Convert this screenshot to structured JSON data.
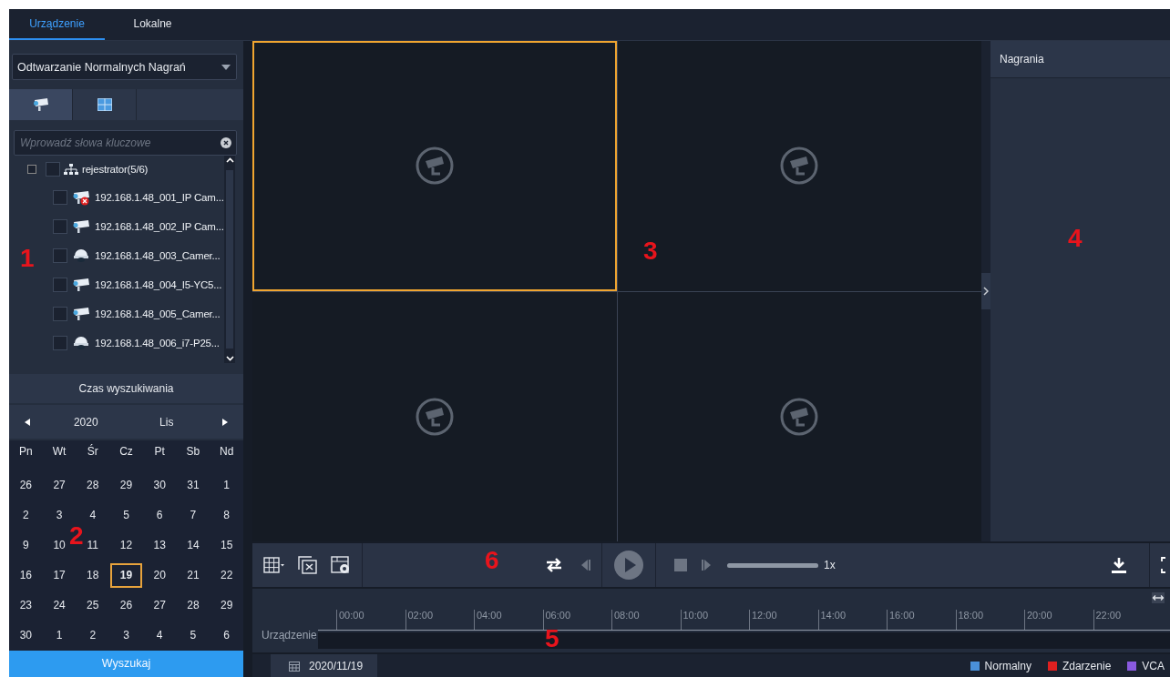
{
  "tabs": [
    {
      "label": "Urządzenie",
      "selected": true
    },
    {
      "label": "Lokalne",
      "selected": false
    }
  ],
  "mode_dropdown": {
    "value": "Odtwarzanie Normalnych Nagrań"
  },
  "view_tabs": [
    {
      "kind": "camera",
      "selected": true
    },
    {
      "kind": "grid",
      "selected": false
    }
  ],
  "search": {
    "placeholder": "Wprowadź słowa kluczowe"
  },
  "tree": {
    "label": "rejestrator(5/6)",
    "checked": false,
    "expanded": true,
    "children": [
      {
        "label": "192.168.1.48_001_IP Cam...",
        "kind": "bullet",
        "offline": true,
        "checked": false
      },
      {
        "label": "192.168.1.48_002_IP Cam...",
        "kind": "bullet",
        "offline": false,
        "checked": false
      },
      {
        "label": "192.168.1.48_003_Camer...",
        "kind": "dome",
        "offline": false,
        "checked": false
      },
      {
        "label": "192.168.1.48_004_I5-YC5...",
        "kind": "bullet",
        "offline": false,
        "checked": false
      },
      {
        "label": "192.168.1.48_005_Camer...",
        "kind": "bullet",
        "offline": false,
        "checked": false
      },
      {
        "label": "192.168.1.48_006_i7-P25...",
        "kind": "dome",
        "offline": false,
        "checked": false
      }
    ]
  },
  "calendar": {
    "title": "Czas wyszukiwania",
    "year": "2020",
    "month": "Lis",
    "weekdays": [
      "Pn",
      "Wt",
      "Śr",
      "Cz",
      "Pt",
      "Sb",
      "Nd"
    ],
    "weeks": [
      [
        {
          "day": "26",
          "selected": false
        },
        {
          "day": "27",
          "selected": false
        },
        {
          "day": "28",
          "selected": false
        },
        {
          "day": "29",
          "selected": false
        },
        {
          "day": "30",
          "selected": false
        },
        {
          "day": "31",
          "selected": false
        },
        {
          "day": "1",
          "selected": false
        }
      ],
      [
        {
          "day": "2",
          "selected": false
        },
        {
          "day": "3",
          "selected": false
        },
        {
          "day": "4",
          "selected": false
        },
        {
          "day": "5",
          "selected": false
        },
        {
          "day": "6",
          "selected": false
        },
        {
          "day": "7",
          "selected": false
        },
        {
          "day": "8",
          "selected": false
        }
      ],
      [
        {
          "day": "9",
          "selected": false
        },
        {
          "day": "10",
          "selected": false
        },
        {
          "day": "11",
          "selected": false
        },
        {
          "day": "12",
          "selected": false
        },
        {
          "day": "13",
          "selected": false
        },
        {
          "day": "14",
          "selected": false
        },
        {
          "day": "15",
          "selected": false
        }
      ],
      [
        {
          "day": "16",
          "selected": false
        },
        {
          "day": "17",
          "selected": false
        },
        {
          "day": "18",
          "selected": false
        },
        {
          "day": "19",
          "selected": true
        },
        {
          "day": "20",
          "selected": false
        },
        {
          "day": "21",
          "selected": false
        },
        {
          "day": "22",
          "selected": false
        }
      ],
      [
        {
          "day": "23",
          "selected": false
        },
        {
          "day": "24",
          "selected": false
        },
        {
          "day": "25",
          "selected": false
        },
        {
          "day": "26",
          "selected": false
        },
        {
          "day": "27",
          "selected": false
        },
        {
          "day": "28",
          "selected": false
        },
        {
          "day": "29",
          "selected": false
        }
      ],
      [
        {
          "day": "30",
          "selected": false
        },
        {
          "day": "1",
          "selected": false
        },
        {
          "day": "2",
          "selected": false
        },
        {
          "day": "3",
          "selected": false
        },
        {
          "day": "4",
          "selected": false
        },
        {
          "day": "5",
          "selected": false
        },
        {
          "day": "6",
          "selected": false
        }
      ]
    ]
  },
  "search_button": "Wyszukaj",
  "video_cells": [
    {
      "selected": true
    },
    {
      "selected": false
    },
    {
      "selected": false
    },
    {
      "selected": false
    }
  ],
  "recordings_panel": {
    "title": "Nagrania"
  },
  "playback": {
    "level": 1,
    "speed": "1x"
  },
  "timeline": {
    "label": "Urządzenie",
    "ticks": [
      "00:00",
      "02:00",
      "04:00",
      "06:00",
      "08:00",
      "10:00",
      "12:00",
      "14:00",
      "16:00",
      "18:00",
      "20:00",
      "22:00"
    ]
  },
  "status_bar": {
    "date": "2020/11/19",
    "legend": [
      {
        "label": "Normalny",
        "color": "#4a90d9"
      },
      {
        "label": "Zdarzenie",
        "color": "#e02020"
      },
      {
        "label": "VCA",
        "color": "#8a5ae0"
      }
    ]
  },
  "annotations": [
    "1",
    "2",
    "3",
    "4",
    "5",
    "6"
  ]
}
